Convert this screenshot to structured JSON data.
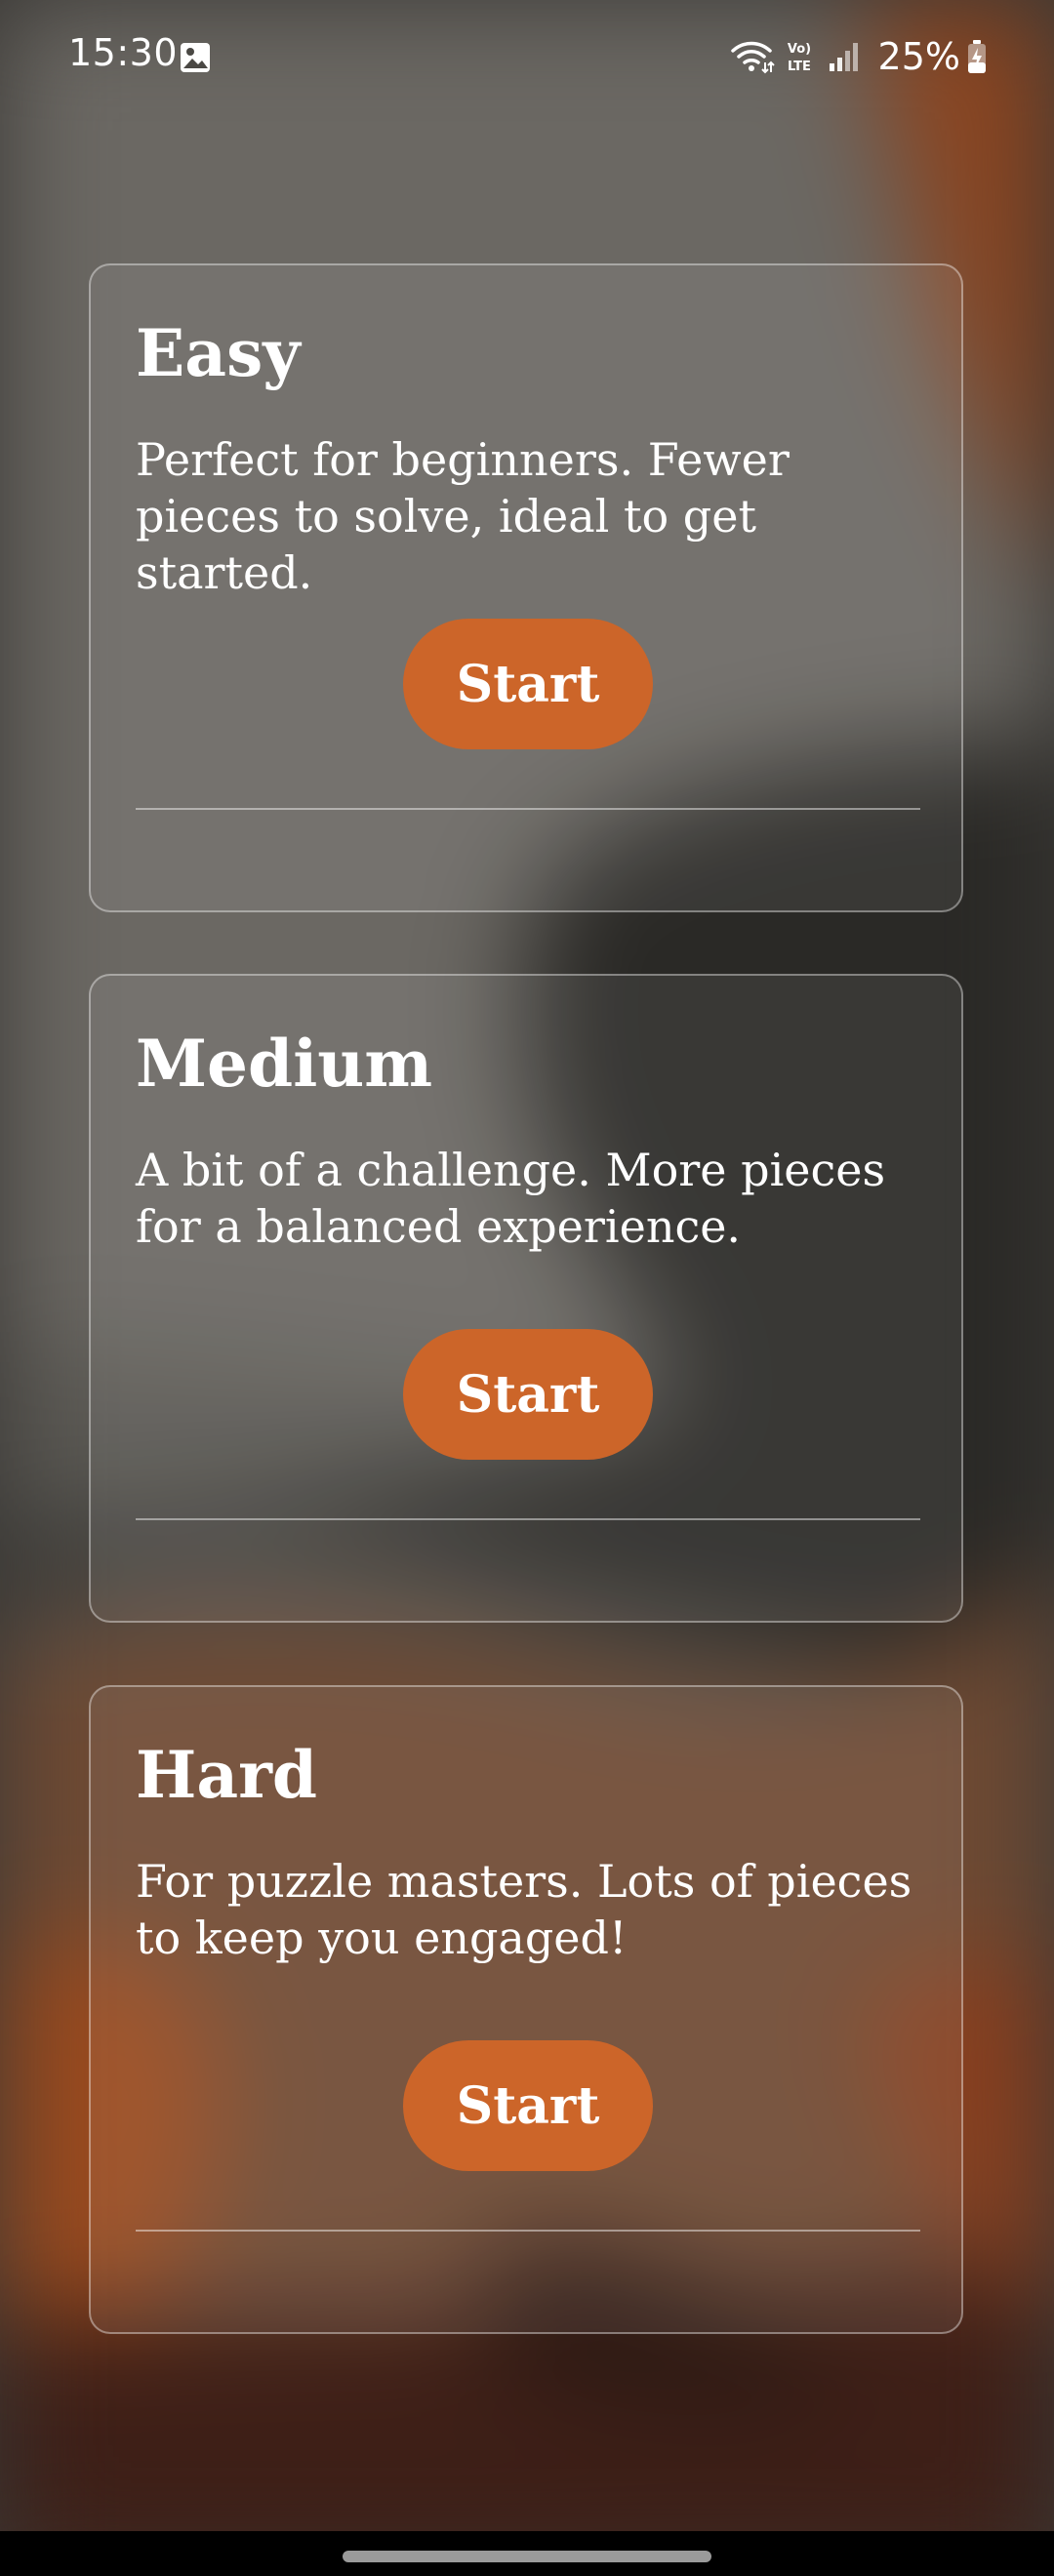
{
  "status_bar": {
    "time": "15:30",
    "battery_percent": "25%",
    "icons": [
      "image-icon",
      "wifi-icon",
      "volte-icon",
      "signal-icon",
      "battery-charging-icon"
    ]
  },
  "cards": [
    {
      "title": "Easy",
      "description": "Perfect for beginners. Fewer pieces to solve, ideal to get started.",
      "button_label": "Start"
    },
    {
      "title": "Medium",
      "description": "A bit of a challenge. More pieces for a balanced experience.",
      "button_label": "Start"
    },
    {
      "title": "Hard",
      "description": "For puzzle masters. Lots of pieces to keep you engaged!",
      "button_label": "Start"
    }
  ],
  "colors": {
    "accent": "#cc6529",
    "background_dark": "#242321",
    "background_grey": "#6a6761",
    "background_orange": "#9a4a1e",
    "nav_bar": "#000000"
  }
}
